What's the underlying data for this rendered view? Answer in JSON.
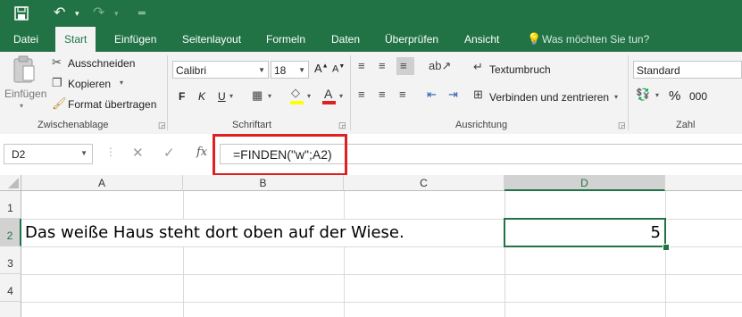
{
  "quick_access": {
    "save": "save-icon",
    "undo": "undo-icon",
    "redo": "redo-icon",
    "customize": "customize-icon"
  },
  "tabs": [
    {
      "label": "Datei"
    },
    {
      "label": "Start"
    },
    {
      "label": "Einfügen"
    },
    {
      "label": "Seitenlayout"
    },
    {
      "label": "Formeln"
    },
    {
      "label": "Daten"
    },
    {
      "label": "Überprüfen"
    },
    {
      "label": "Ansicht"
    }
  ],
  "tell_me": "Was möchten Sie tun?",
  "clipboard": {
    "paste_label": "Einfügen",
    "cut_label": "Ausschneiden",
    "copy_label": "Kopieren",
    "format_painter_label": "Format übertragen",
    "group_label": "Zwischenablage"
  },
  "font": {
    "font_name": "Calibri",
    "font_size": "18",
    "bold": "F",
    "italic": "K",
    "underline": "U",
    "font_color_letter": "A",
    "group_label": "Schriftart"
  },
  "alignment": {
    "wrap_text": "Textumbruch",
    "merge_center": "Verbinden und zentrieren",
    "group_label": "Ausrichtung"
  },
  "number": {
    "format": "Standard",
    "percent": "%",
    "thousands": "000",
    "group_label": "Zahl"
  },
  "formula_bar": {
    "name_box": "D2",
    "fx": "fx",
    "formula": "=FINDEN(\"w\";A2)"
  },
  "columns": [
    "A",
    "B",
    "C",
    "D"
  ],
  "rows": [
    "1",
    "2",
    "3",
    "4"
  ],
  "cells": {
    "A2": "Das weiße Haus steht dort oben auf der Wiese.",
    "D2": "5"
  },
  "colors": {
    "accent": "#217346",
    "highlight_box": "#e02020"
  }
}
